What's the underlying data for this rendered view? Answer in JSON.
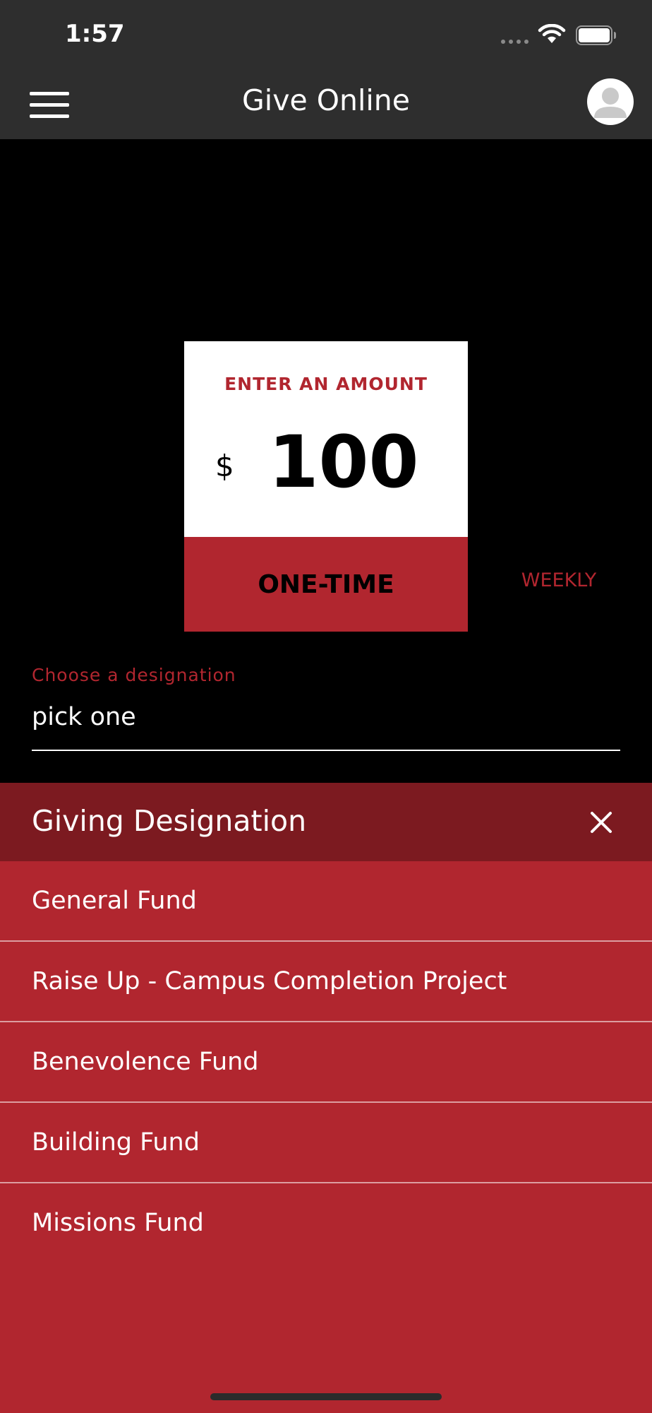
{
  "status_bar": {
    "time": "1:57"
  },
  "header": {
    "title": "Give Online",
    "menu_icon": "hamburger-menu-icon",
    "profile_icon": "user-avatar-icon"
  },
  "amount_card": {
    "label": "ENTER AN AMOUNT",
    "currency": "$",
    "amount": "100"
  },
  "frequency": {
    "selected_label": "ONE-TIME",
    "other_label": "WEEKLY"
  },
  "designation_field": {
    "label": "Choose a designation",
    "value": "pick one"
  },
  "picker": {
    "title": "Giving Designation",
    "close_icon": "close-icon",
    "options": [
      {
        "label": "General Fund"
      },
      {
        "label": "Raise Up - Campus Completion Project"
      },
      {
        "label": "Benevolence Fund"
      },
      {
        "label": "Building Fund"
      },
      {
        "label": "Missions Fund"
      }
    ]
  },
  "colors": {
    "accent_red": "#b1262f",
    "picker_header": "#7c1a20",
    "header_bg": "#2e2e2e",
    "background": "#000000"
  }
}
